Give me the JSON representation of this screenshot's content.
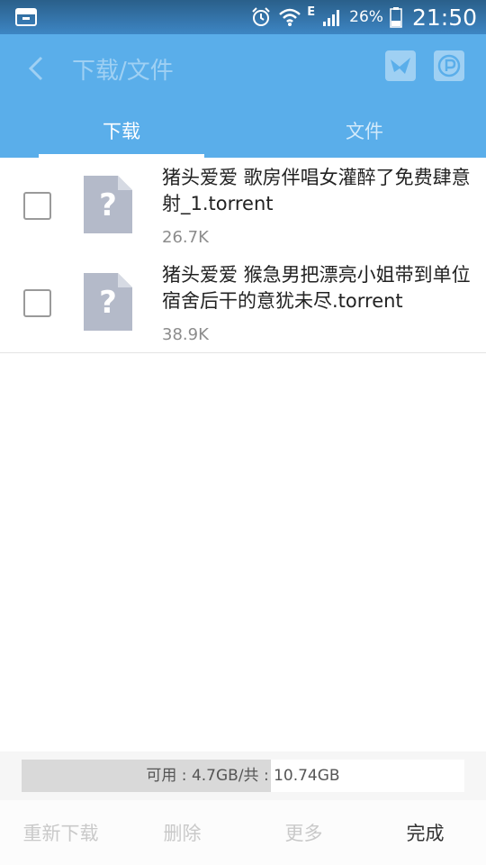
{
  "status_bar": {
    "network_type": "E",
    "battery_percent": "26%",
    "time": "21:50",
    "icons": [
      "notification-icon",
      "alarm-icon",
      "wifi-icon",
      "signal-icon",
      "battery-icon"
    ]
  },
  "header": {
    "title": "下载/文件",
    "background_color": "#5aaeea",
    "icons": [
      "back-arrow-icon",
      "share-bird-icon",
      "p-badge-icon"
    ]
  },
  "tabs": [
    {
      "label": "下载",
      "active": true
    },
    {
      "label": "文件",
      "active": false
    }
  ],
  "files": [
    {
      "name": "猪头爱爱  歌房伴唱女灌醉了免费肆意射_1.torrent",
      "size": "26.7K",
      "checked": false,
      "icon": "unknown-file-icon"
    },
    {
      "name": "猪头爱爱  猴急男把漂亮小姐带到单位宿舍后干的意犹未尽.torrent",
      "size": "38.9K",
      "checked": false,
      "icon": "unknown-file-icon"
    }
  ],
  "storage": {
    "text": "可用 : 4.7GB/共 : 10.74GB",
    "available_gb": 4.7,
    "total_gb": 10.74
  },
  "actions": [
    {
      "label": "重新下载",
      "enabled": false
    },
    {
      "label": "删除",
      "enabled": false
    },
    {
      "label": "更多",
      "enabled": false
    },
    {
      "label": "完成",
      "enabled": true
    }
  ]
}
